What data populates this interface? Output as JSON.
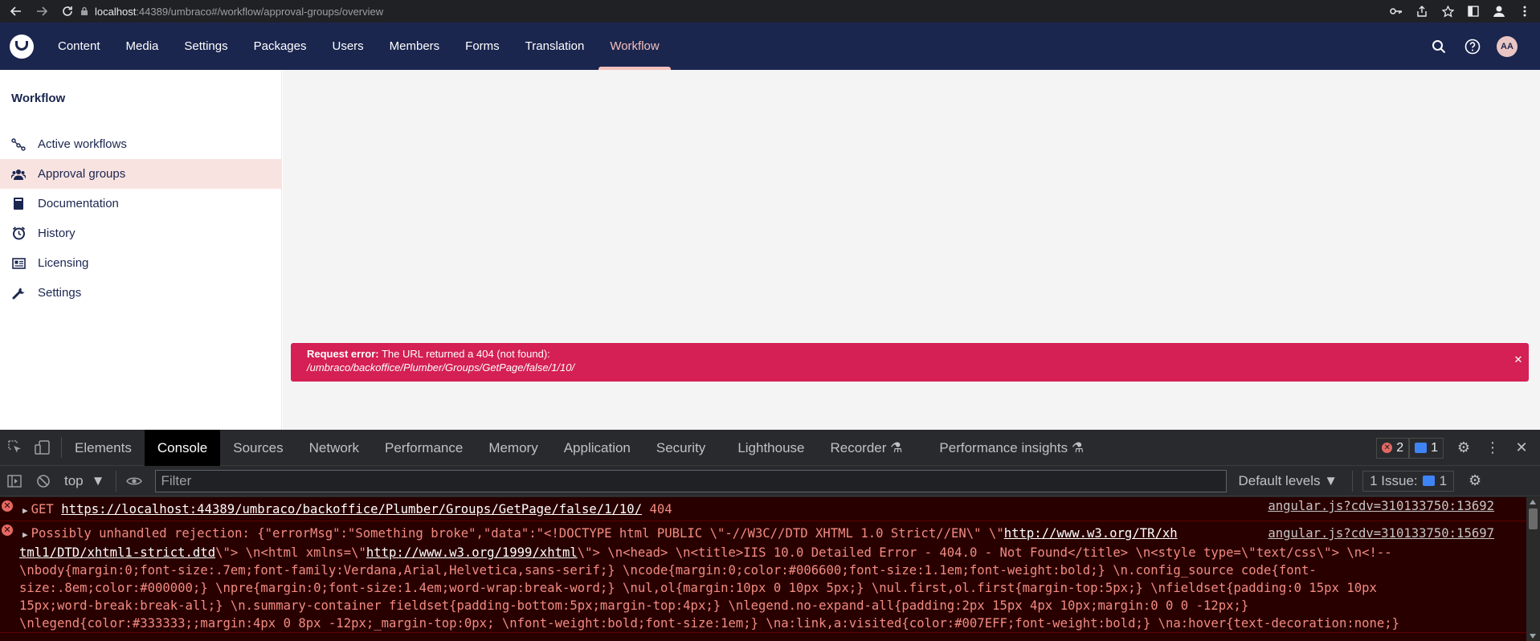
{
  "browser": {
    "url_host": "localhost",
    "url_rest": ":44389/umbraco#/workflow/approval-groups/overview",
    "icons": [
      "back-icon",
      "forward-icon",
      "reload-icon",
      "lock-icon",
      "key-icon",
      "share-icon",
      "star-icon",
      "sidepanel-icon",
      "profile-icon",
      "menu-icon"
    ]
  },
  "header": {
    "sections": [
      "Content",
      "Media",
      "Settings",
      "Packages",
      "Users",
      "Members",
      "Forms",
      "Translation",
      "Workflow"
    ],
    "active_section": "Workflow",
    "avatar_initials": "AA",
    "colors": {
      "header_bg": "#1b264f",
      "active": "#f5c1bc"
    }
  },
  "tree": {
    "title": "Workflow",
    "items": [
      {
        "label": "Active workflows",
        "icon": "workflow-icon",
        "active": false
      },
      {
        "label": "Approval groups",
        "icon": "users-icon",
        "active": true
      },
      {
        "label": "Documentation",
        "icon": "book-icon",
        "active": false
      },
      {
        "label": "History",
        "icon": "clock-icon",
        "active": false
      },
      {
        "label": "Licensing",
        "icon": "license-icon",
        "active": false
      },
      {
        "label": "Settings",
        "icon": "wrench-icon",
        "active": false
      }
    ]
  },
  "notification": {
    "title": "Request error:",
    "message": "The URL returned a 404 (not found):",
    "path": "/umbraco/backoffice/Plumber/Groups/GetPage/false/1/10/",
    "color": "#d42054"
  },
  "devtools": {
    "tabs": [
      "Elements",
      "Console",
      "Sources",
      "Network",
      "Performance",
      "Memory",
      "Application",
      "Security",
      "Lighthouse",
      "Recorder",
      "Performance insights"
    ],
    "active_tab": "Console",
    "error_count": "2",
    "message_count": "1",
    "context": "top",
    "filter_placeholder": "Filter",
    "levels": "Default levels",
    "issues_label": "1 Issue:",
    "issues_count": "1",
    "logs": [
      {
        "method": "GET",
        "url": "https://localhost:44389/umbraco/backoffice/Plumber/Groups/GetPage/false/1/10/",
        "status": "404",
        "source": "angular.js?cdv=310133750:13692"
      },
      {
        "prefix": "Possibly unhandled rejection: {\"errorMsg\":\"Something broke\",\"data\":\"<!DOCTYPE html PUBLIC \\\"-//W3C//DTD XHTML 1.0 Strict//EN\\\" \\\"",
        "link1": "http://www.w3.org/TR/xh",
        "link1b": "tml1/DTD/xhtml1-strict.dtd",
        "mid1": "\\\"> \\n<html xmlns=\\\"",
        "link2": "http://www.w3.org/1999/xhtml",
        "rest1": "\\\"> \\n<head> \\n<title>IIS 10.0 Detailed Error - 404.0 - Not Found</title> \\n<style type=\\\"text/css\\\"> \\n<!-- ",
        "rest2": "\\nbody{margin:0;font-size:.7em;font-family:Verdana,Arial,Helvetica,sans-serif;} \\ncode{margin:0;color:#006600;font-size:1.1em;font-weight:bold;} \\n.config_source code{font-",
        "rest3": "size:.8em;color:#000000;} \\npre{margin:0;font-size:1.4em;word-wrap:break-word;} \\nul,ol{margin:10px 0 10px 5px;} \\nul.first,ol.first{margin-top:5px;} \\nfieldset{padding:0 15px 10px",
        "rest4": "15px;word-break:break-all;} \\n.summary-container fieldset{padding-bottom:5px;margin-top:4px;} \\nlegend.no-expand-all{padding:2px 15px 4px 10px;margin:0 0 0 -12px;}",
        "rest5": "\\nlegend{color:#333333;;margin:4px 0 8px -12px;_margin-top:0px; \\nfont-weight:bold;font-size:1em;} \\na:link,a:visited{color:#007EFF;font-weight:bold;} \\na:hover{text-decoration:none;}",
        "source": "angular.js?cdv=310133750:15697"
      }
    ]
  }
}
